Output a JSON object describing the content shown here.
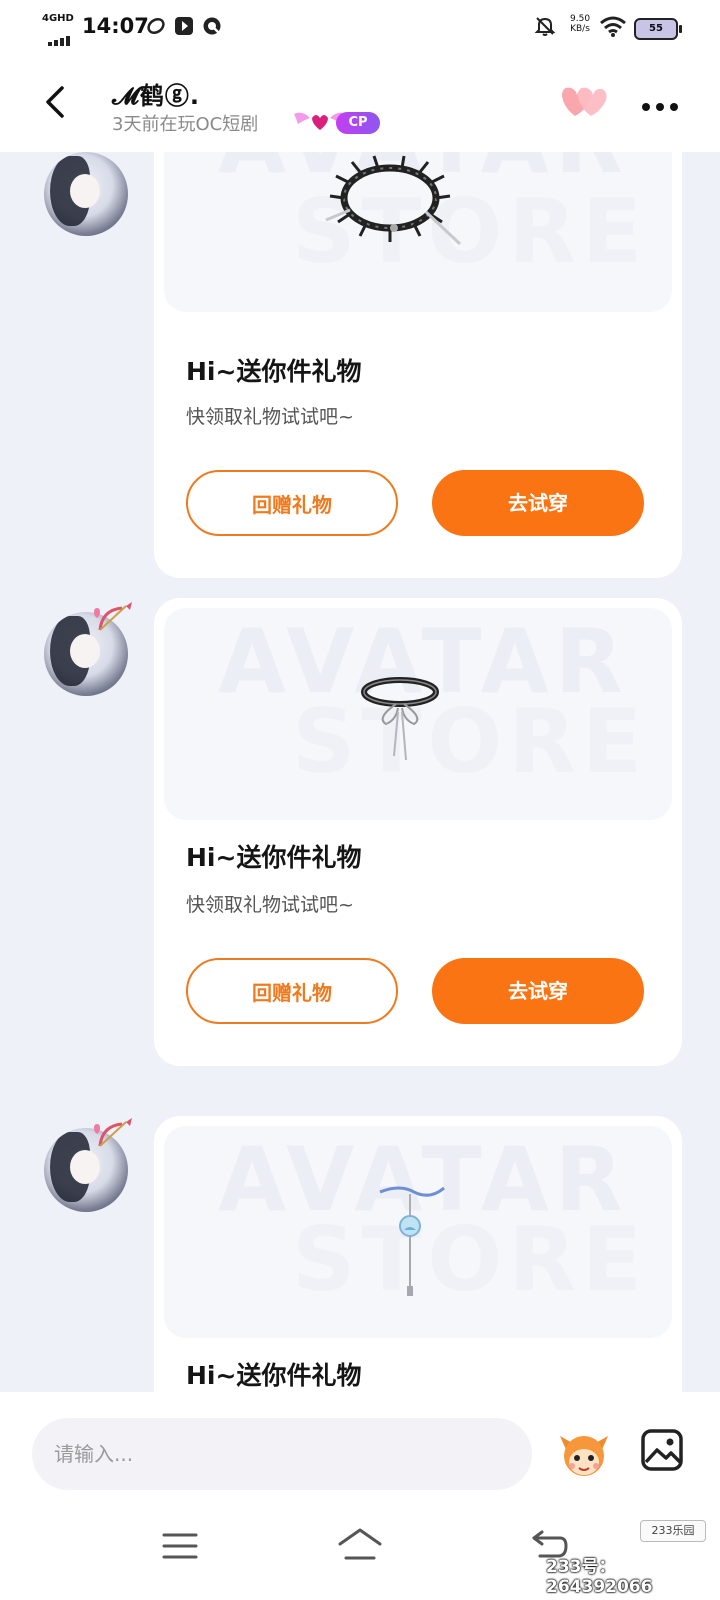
{
  "status_bar": {
    "network": "4GHD",
    "time": "14:07",
    "speed_value": "9.50",
    "speed_unit": "KB/s",
    "battery": "55"
  },
  "header": {
    "username": "𝓜鹤ⓖ.",
    "subtitle": "3天前在玩OC短剧",
    "cp_badge": "CP"
  },
  "messages": [
    {
      "title": "Hi~送你件礼物",
      "subtitle": "快领取礼物试试吧~",
      "return_gift_label": "回赠礼物",
      "try_on_label": "去试穿",
      "watermark_top": "AVATAR",
      "watermark_bottom": "STORE",
      "item_icon": "spiked-choker-icon"
    },
    {
      "title": "Hi~送你件礼物",
      "subtitle": "快领取礼物试试吧~",
      "return_gift_label": "回赠礼物",
      "try_on_label": "去试穿",
      "watermark_top": "AVATAR",
      "watermark_bottom": "STORE",
      "item_icon": "ribbon-choker-icon"
    },
    {
      "title": "Hi~送你件礼物",
      "watermark_top": "AVATAR",
      "watermark_bottom": "STORE",
      "item_icon": "wind-chime-ornament-icon"
    }
  ],
  "input": {
    "placeholder": "请输入..."
  },
  "watermark": {
    "brand": "233乐园",
    "id": "233号：264392066"
  },
  "colors": {
    "accent": "#fb7413",
    "cp_badge": "#b04af0",
    "background": "#eef1f8"
  }
}
